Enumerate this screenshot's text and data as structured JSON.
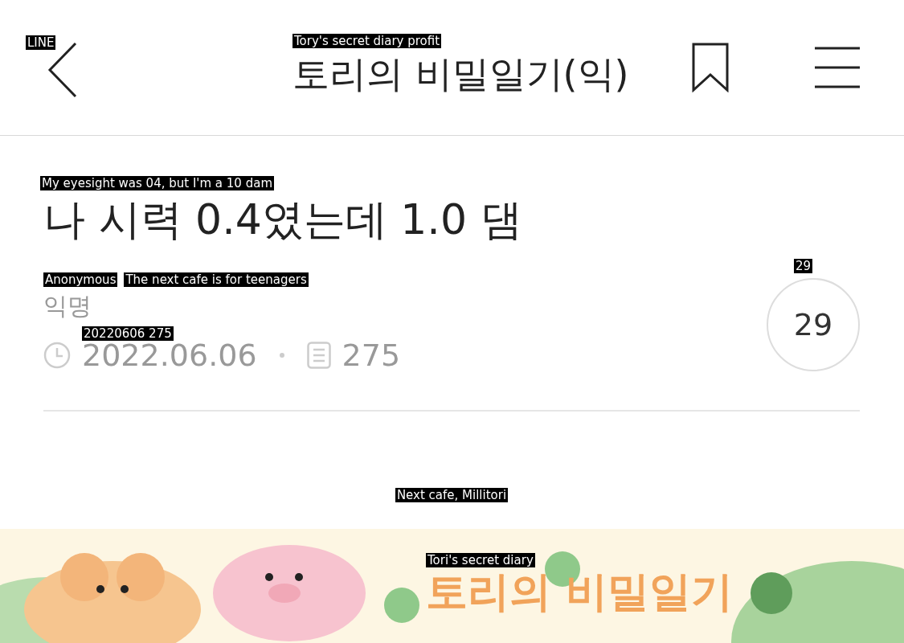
{
  "header": {
    "back": {
      "overlay": "LINE"
    },
    "title": {
      "text": "토리의 비밀일기(익)",
      "overlay": "Tory's secret diary profit"
    },
    "bookmarked": false
  },
  "post": {
    "title": {
      "text": "나 시력 0.4였는데 1.0 댐",
      "overlay": "My eyesight was 04, but I'm a 10 dam"
    },
    "author": {
      "text": "익명",
      "overlays": [
        "Anonymous",
        "The next cafe is for teenagers"
      ]
    },
    "date": {
      "text": "2022.06.06",
      "overlay": "20220606 275"
    },
    "views": "275",
    "comments": {
      "count": "29",
      "overlay": "29"
    }
  },
  "watermark_overlay": "Next cafe, Millitori",
  "banner": {
    "title": "토리의 비밀일기",
    "overlay": "Tori's secret diary"
  }
}
